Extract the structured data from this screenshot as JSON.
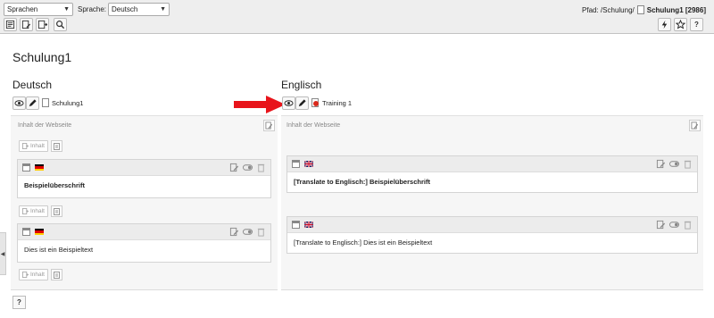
{
  "topbar": {
    "lang_select": "Sprachen",
    "sprache_label": "Sprache:",
    "sprache_select": "Deutsch",
    "path_label": "Pfad: /Schulung/",
    "path_page": "Schulung1 [2986]"
  },
  "page_title": "Schulung1",
  "left": {
    "lang": "Deutsch",
    "page_label": "Schulung1",
    "content_header": "Inhalt der Webseite",
    "add_label": "Inhalt",
    "elements": [
      {
        "text": "Beispielüberschrift",
        "bold": true,
        "flag": "de"
      },
      {
        "text": "Dies ist ein Beispieltext",
        "bold": false,
        "flag": "de"
      }
    ]
  },
  "right": {
    "lang": "Englisch",
    "page_label": "Training 1",
    "content_header": "Inhalt der Webseite",
    "elements": [
      {
        "text": "[Translate to Englisch:] Beispielüberschrift",
        "bold": true,
        "flag": "en"
      },
      {
        "text": "[Translate to Englisch:] Dies ist ein Beispieltext",
        "bold": false,
        "flag": "en"
      }
    ]
  },
  "help_label": "?",
  "colors": {
    "arrow": "#e8141b",
    "topbar_bg": "#eeeeee"
  }
}
